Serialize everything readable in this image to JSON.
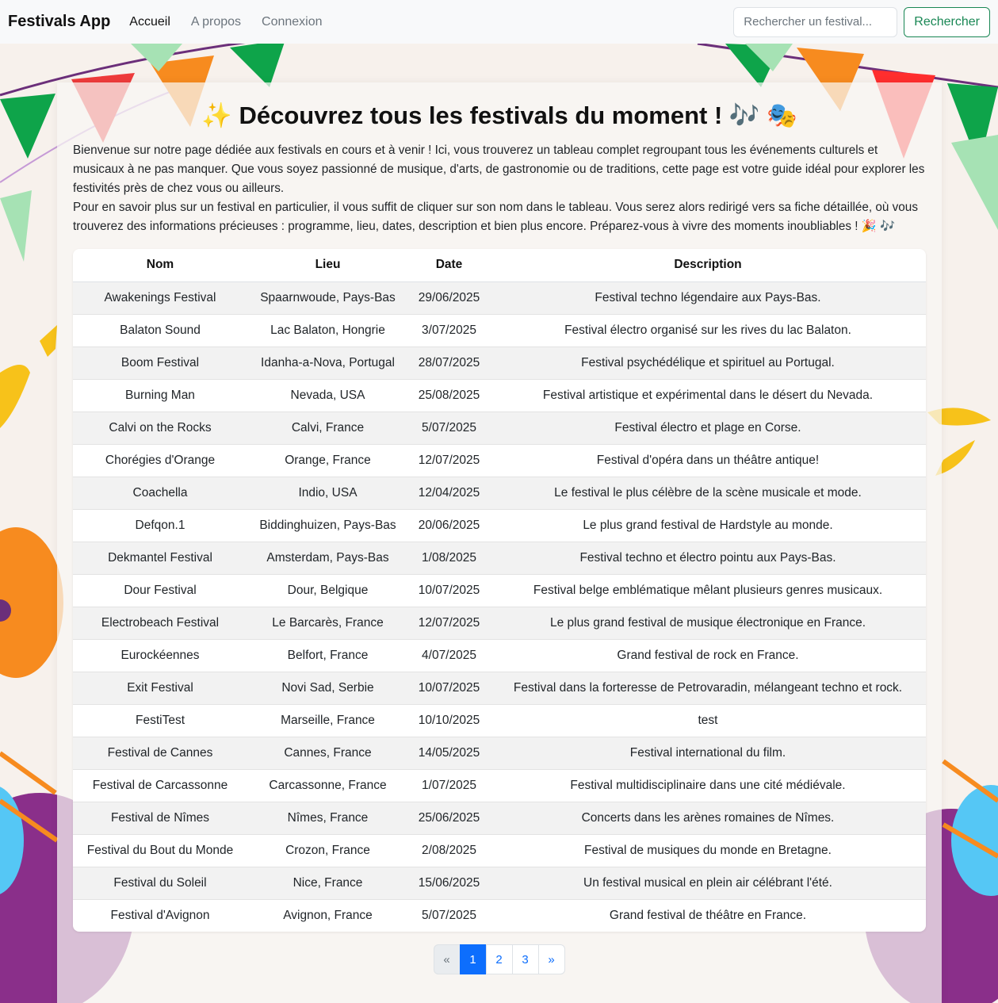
{
  "navbar": {
    "brand": "Festivals App",
    "links": [
      "Accueil",
      "A propos",
      "Connexion"
    ],
    "search_placeholder": "Rechercher un festival...",
    "search_button": "Rechercher"
  },
  "main": {
    "title": "✨ Découvrez tous les festivals du moment ! 🎶 🎭",
    "intro_1": "Bienvenue sur notre page dédiée aux festivals en cours et à venir ! Ici, vous trouverez un tableau complet regroupant tous les événements culturels et musicaux à ne pas manquer. Que vous soyez passionné de musique, d'arts, de gastronomie ou de traditions, cette page est votre guide idéal pour explorer les festivités près de chez vous ou ailleurs.",
    "intro_2": "Pour en savoir plus sur un festival en particulier, il vous suffit de cliquer sur son nom dans le tableau. Vous serez alors redirigé vers sa fiche détaillée, où vous trouverez des informations précieuses : programme, lieu, dates, description et bien plus encore. Préparez-vous à vivre des moments inoubliables ! 🎉 🎶"
  },
  "table": {
    "headers": [
      "Nom",
      "Lieu",
      "Date",
      "Description"
    ],
    "rows": [
      [
        "Awakenings Festival",
        "Spaarnwoude, Pays-Bas",
        "29/06/2025",
        "Festival techno légendaire aux Pays-Bas."
      ],
      [
        "Balaton Sound",
        "Lac Balaton, Hongrie",
        "3/07/2025",
        "Festival électro organisé sur les rives du lac Balaton."
      ],
      [
        "Boom Festival",
        "Idanha-a-Nova, Portugal",
        "28/07/2025",
        "Festival psychédélique et spirituel au Portugal."
      ],
      [
        "Burning Man",
        "Nevada, USA",
        "25/08/2025",
        "Festival artistique et expérimental dans le désert du Nevada."
      ],
      [
        "Calvi on the Rocks",
        "Calvi, France",
        "5/07/2025",
        "Festival électro et plage en Corse."
      ],
      [
        "Chorégies d'Orange",
        "Orange, France",
        "12/07/2025",
        "Festival d'opéra dans un théâtre antique!"
      ],
      [
        "Coachella",
        "Indio, USA",
        "12/04/2025",
        "Le festival le plus célèbre de la scène musicale et mode."
      ],
      [
        "Defqon.1",
        "Biddinghuizen, Pays-Bas",
        "20/06/2025",
        "Le plus grand festival de Hardstyle au monde."
      ],
      [
        "Dekmantel Festival",
        "Amsterdam, Pays-Bas",
        "1/08/2025",
        "Festival techno et électro pointu aux Pays-Bas."
      ],
      [
        "Dour Festival",
        "Dour, Belgique",
        "10/07/2025",
        "Festival belge emblématique mêlant plusieurs genres musicaux."
      ],
      [
        "Electrobeach Festival",
        "Le Barcarès, France",
        "12/07/2025",
        "Le plus grand festival de musique électronique en France."
      ],
      [
        "Eurockéennes",
        "Belfort, France",
        "4/07/2025",
        "Grand festival de rock en France."
      ],
      [
        "Exit Festival",
        "Novi Sad, Serbie",
        "10/07/2025",
        "Festival dans la forteresse de Petrovaradin, mélangeant techno et rock."
      ],
      [
        "FestiTest",
        "Marseille, France",
        "10/10/2025",
        "test"
      ],
      [
        "Festival de Cannes",
        "Cannes, France",
        "14/05/2025",
        "Festival international du film."
      ],
      [
        "Festival de Carcassonne",
        "Carcassonne, France",
        "1/07/2025",
        "Festival multidisciplinaire dans une cité médiévale."
      ],
      [
        "Festival de Nîmes",
        "Nîmes, France",
        "25/06/2025",
        "Concerts dans les arènes romaines de Nîmes."
      ],
      [
        "Festival du Bout du Monde",
        "Crozon, France",
        "2/08/2025",
        "Festival de musiques du monde en Bretagne."
      ],
      [
        "Festival du Soleil",
        "Nice, France",
        "15/06/2025",
        "Un festival musical en plein air célébrant l'été."
      ],
      [
        "Festival d'Avignon",
        "Avignon, France",
        "5/07/2025",
        "Grand festival de théâtre en France."
      ]
    ]
  },
  "pagination": {
    "prev": "«",
    "pages": [
      "1",
      "2",
      "3"
    ],
    "active": "1",
    "next": "»"
  }
}
